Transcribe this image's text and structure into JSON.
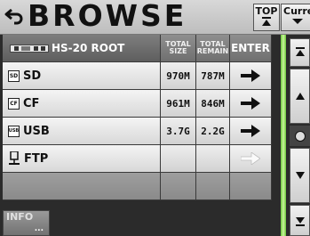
{
  "header": {
    "title": "BROWSE",
    "top_button": "TOP",
    "current_button": "Current"
  },
  "table": {
    "root_label": "HS-20 ROOT",
    "col_total_size": [
      "TOTAL",
      "SIZE"
    ],
    "col_total_remain": [
      "TOTAL",
      "REMAIN"
    ],
    "col_enter": "ENTER",
    "rows": [
      {
        "icon": "sd-card-icon",
        "icon_text": "SD",
        "label": "SD",
        "size": "970M",
        "remain": "787M",
        "enabled": true
      },
      {
        "icon": "cf-card-icon",
        "icon_text": "CF",
        "label": "CF",
        "size": "961M",
        "remain": "846M",
        "enabled": true
      },
      {
        "icon": "usb-icon",
        "icon_text": "USB",
        "label": "USB",
        "size": "3.7G",
        "remain": "2.2G",
        "enabled": true
      },
      {
        "icon": "ftp-icon",
        "icon_text": "",
        "label": "FTP",
        "size": "",
        "remain": "",
        "enabled": false
      }
    ]
  },
  "footer": {
    "info_label": "INFO",
    "info_dots": "..."
  },
  "colors": {
    "scroll_strip": "#6cc83a",
    "enabled_arrow": "#111111",
    "disabled_arrow": "#ffffff"
  }
}
